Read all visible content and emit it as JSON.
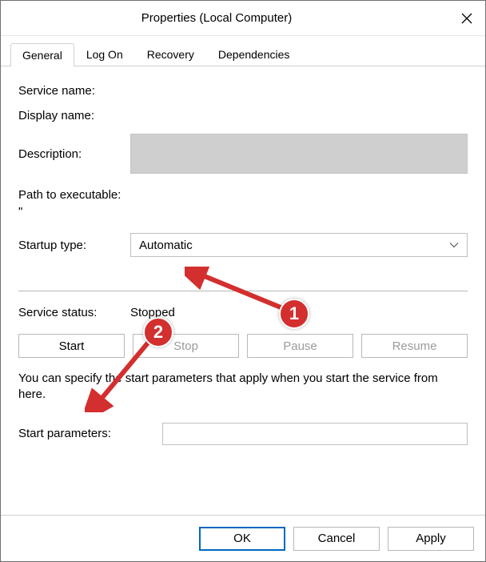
{
  "window": {
    "title": "Properties (Local Computer)"
  },
  "tabs": [
    {
      "label": "General",
      "active": true
    },
    {
      "label": "Log On",
      "active": false
    },
    {
      "label": "Recovery",
      "active": false
    },
    {
      "label": "Dependencies",
      "active": false
    }
  ],
  "fields": {
    "service_name_label": "Service name:",
    "service_name_value": "",
    "display_name_label": "Display name:",
    "display_name_value": "",
    "description_label": "Description:",
    "description_value": "",
    "path_label": "Path to executable:",
    "path_value": "\"",
    "startup_type_label": "Startup type:",
    "startup_type_value": "Automatic"
  },
  "status": {
    "label": "Service status:",
    "value": "Stopped"
  },
  "buttons": {
    "start": "Start",
    "stop": "Stop",
    "pause": "Pause",
    "resume": "Resume"
  },
  "hint": "You can specify the start parameters that apply when you start the service from here.",
  "parameters": {
    "label": "Start parameters:",
    "value": ""
  },
  "footer": {
    "ok": "OK",
    "cancel": "Cancel",
    "apply": "Apply"
  },
  "annotations": {
    "marker1": "1",
    "marker2": "2"
  }
}
